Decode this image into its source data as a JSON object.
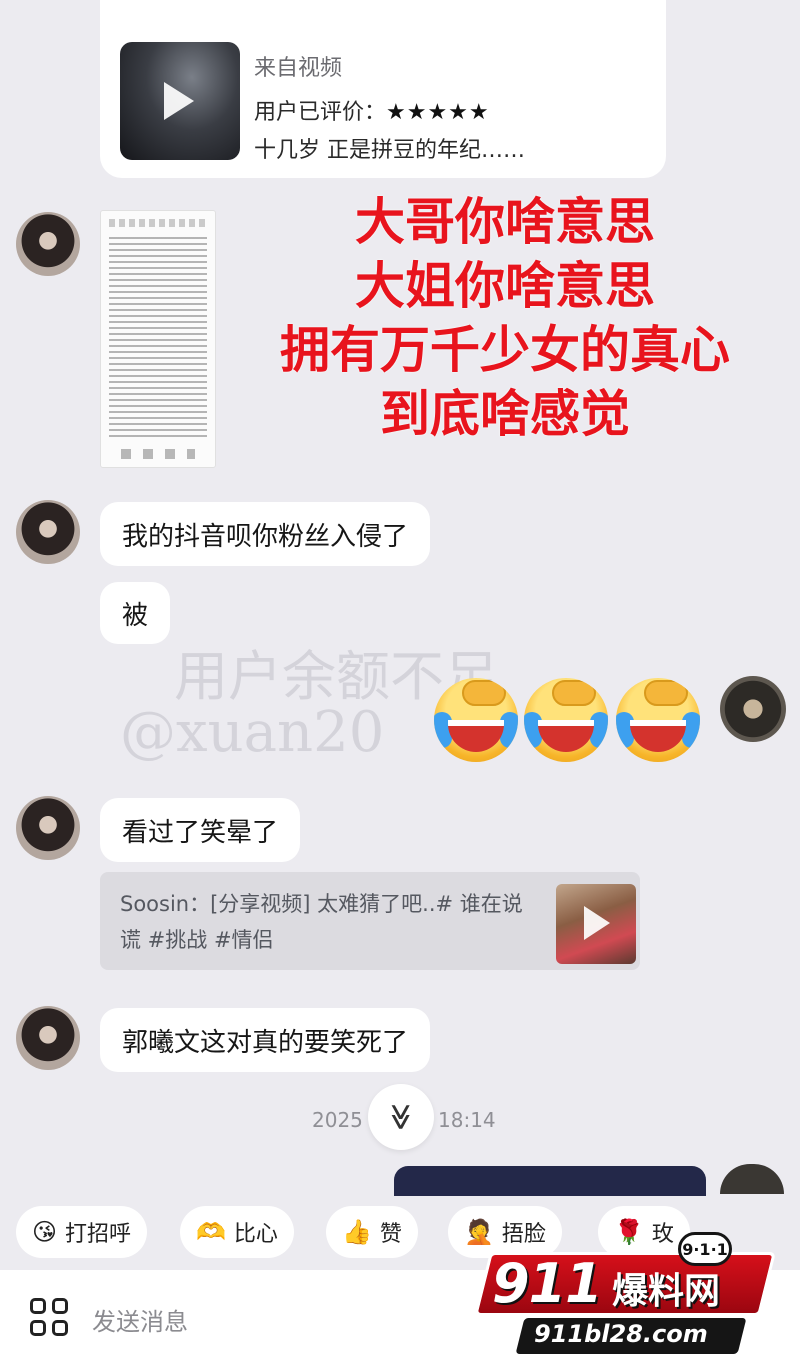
{
  "video_card": {
    "source": "来自视频",
    "rating_label": "用户已评价：",
    "stars": "★★★★★",
    "description": "十几岁 正是拼豆的年纪……"
  },
  "caption": {
    "line1": "大哥你啥意思",
    "line2": "大姐你啥意思",
    "line3": "拥有万千少女的真心",
    "line4": "到底啥感觉"
  },
  "messages": {
    "m1": "我的抖音呗你粉丝入侵了",
    "m2": "被",
    "m3": "看过了笑晕了",
    "m4": "郭曦文这对真的要笑死了"
  },
  "watermark": {
    "line1": "用户余额不足",
    "line2": "@xuan20"
  },
  "shared_video": {
    "text": "Soosin：[分享视频] 太难猜了吧..# 谁在说谎 #挑战 #情侣"
  },
  "timestamp": {
    "date": "2025",
    "time": "18:14"
  },
  "scroll_glyph": "≫",
  "quick_replies": [
    {
      "icon": "😘",
      "label": "打招呼"
    },
    {
      "icon": "🫶",
      "label": "比心"
    },
    {
      "icon": "👍",
      "label": "赞"
    },
    {
      "icon": "🤦",
      "label": "捂脸"
    },
    {
      "icon": "🌹",
      "label": "玫"
    }
  ],
  "input": {
    "placeholder": "发送消息"
  },
  "logo": {
    "brand_number": "911",
    "brand_name": "爆料网",
    "url": "911bl28.com",
    "badge": "9·1·1"
  }
}
